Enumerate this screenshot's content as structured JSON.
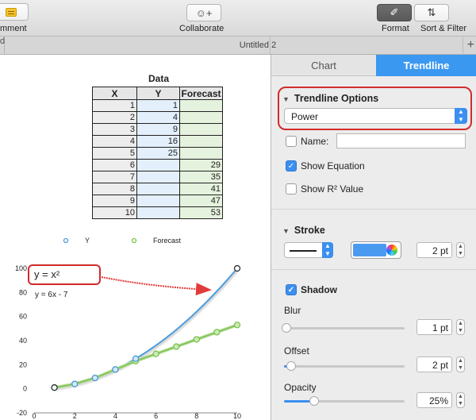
{
  "toolbar": {
    "comment_label": "mment",
    "collaborate_label": "Collaborate",
    "format_label": "Format",
    "sort_filter_label": "Sort & Filter"
  },
  "tabbar": {
    "left_tab": "d",
    "document_title": "Untitled 2",
    "plus": "+"
  },
  "table": {
    "title": "Data",
    "headers": [
      "X",
      "Y",
      "Forecast"
    ],
    "rows": [
      [
        "1",
        "1",
        ""
      ],
      [
        "2",
        "4",
        ""
      ],
      [
        "3",
        "9",
        ""
      ],
      [
        "4",
        "16",
        ""
      ],
      [
        "5",
        "25",
        ""
      ],
      [
        "6",
        "",
        "29"
      ],
      [
        "7",
        "",
        "35"
      ],
      [
        "8",
        "",
        "41"
      ],
      [
        "9",
        "",
        "47"
      ],
      [
        "10",
        "",
        "53"
      ]
    ]
  },
  "annotation": {
    "equation": "y = x²"
  },
  "chart_data": {
    "type": "scatter",
    "legend": [
      "Y",
      "Forecast"
    ],
    "legend_position": "top",
    "series": [
      {
        "name": "Y",
        "x": [
          1,
          2,
          3,
          4,
          5
        ],
        "y": [
          1,
          4,
          9,
          16,
          25
        ],
        "color": "#4a9bdc"
      },
      {
        "name": "Forecast",
        "x": [
          1,
          2,
          3,
          4,
          5,
          6,
          7,
          8,
          9,
          10
        ],
        "y": [
          1,
          4,
          9,
          16,
          23,
          29,
          35,
          41,
          47,
          53
        ],
        "color": "#7ac24e"
      }
    ],
    "trendlines": [
      {
        "series": "Y",
        "type": "power",
        "equation": "y = x²",
        "color": "#4a9bdc"
      },
      {
        "series": "Forecast",
        "type": "linear",
        "equation": "y = 6x - 7",
        "color": "#7ac24e"
      }
    ],
    "xlim": [
      0,
      10
    ],
    "ylim": [
      -20,
      100
    ],
    "x_ticks": [
      0,
      2,
      4,
      6,
      8,
      10
    ],
    "y_ticks": [
      -20,
      0,
      20,
      40,
      60,
      80,
      100
    ],
    "grid": false
  },
  "inspector": {
    "tabs": [
      "Chart",
      "Trendline"
    ],
    "active_tab": "Trendline",
    "trendline_options_title": "Trendline Options",
    "trendline_type": "Power",
    "name_label": "Name:",
    "name_value": "",
    "name_checked": false,
    "show_equation_label": "Show Equation",
    "show_equation_checked": true,
    "show_r2_label": "Show R² Value",
    "show_r2_checked": false,
    "stroke_title": "Stroke",
    "stroke_color": "#4a9bf0",
    "stroke_width": "2 pt",
    "shadow_label": "Shadow",
    "shadow_checked": true,
    "blur_label": "Blur",
    "blur_value": "1 pt",
    "blur_level": 0.02,
    "offset_label": "Offset",
    "offset_value": "2 pt",
    "offset_level": 0.06,
    "opacity_label": "Opacity",
    "opacity_value": "25%",
    "opacity_level": 0.25,
    "accent_color": "#3b98f0",
    "highlight_color": "#d12b2b"
  }
}
